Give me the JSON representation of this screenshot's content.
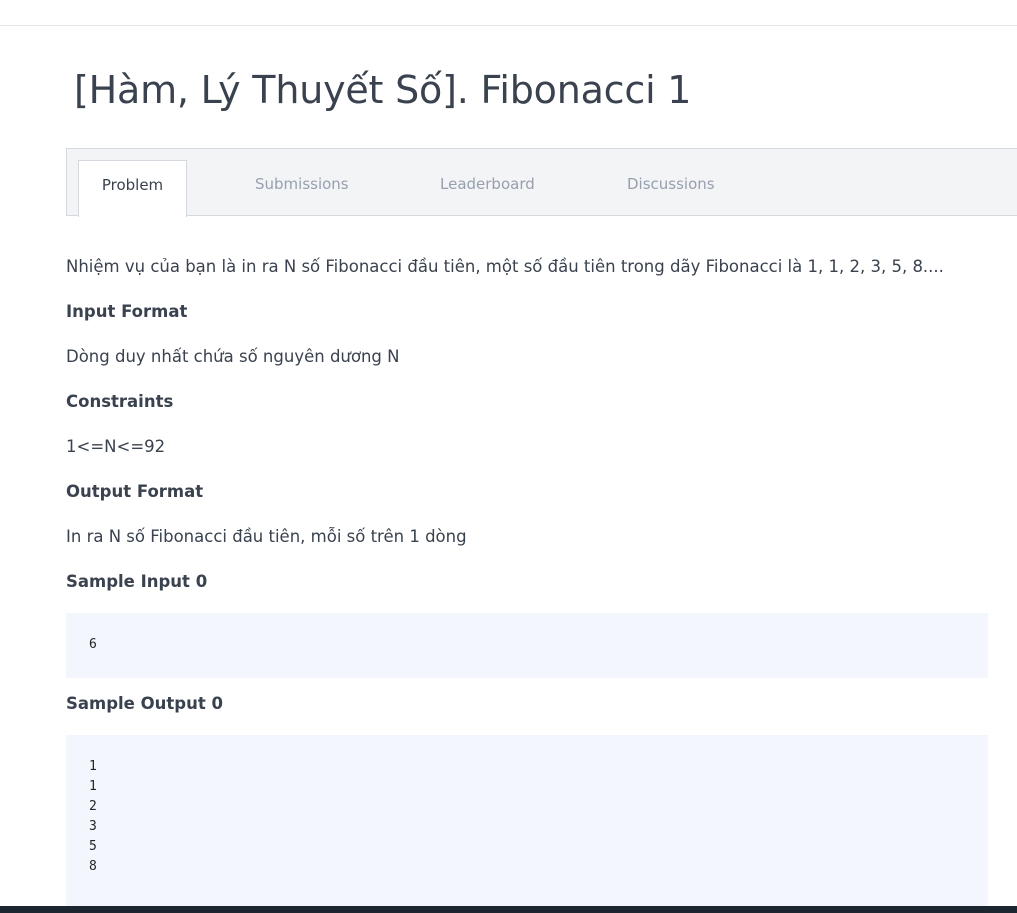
{
  "page": {
    "title": "[Hàm, Lý Thuyết Số]. Fibonacci 1"
  },
  "tabs": [
    {
      "label": "Problem",
      "active": true
    },
    {
      "label": "Submissions",
      "active": false
    },
    {
      "label": "Leaderboard",
      "active": false
    },
    {
      "label": "Discussions",
      "active": false
    }
  ],
  "problem": {
    "statement": "Nhiệm vụ của bạn là in ra N số Fibonacci đầu tiên, một số đầu tiên trong dãy Fibonacci là 1, 1, 2, 3, 5, 8....",
    "input_format_heading": "Input Format",
    "input_format": "Dòng duy nhất chứa số nguyên dương N",
    "constraints_heading": "Constraints",
    "constraints": "1<=N<=92",
    "output_format_heading": "Output Format",
    "output_format": "In ra N số Fibonacci đầu tiên, mỗi số trên 1 dòng",
    "sample_input_heading": "Sample Input 0",
    "sample_input": "6",
    "sample_output_heading": "Sample Output 0",
    "sample_output": "1\n1\n2\n3\n5\n8"
  },
  "colors": {
    "text": "#39424e",
    "muted_tab": "#979faf",
    "code_bg": "#f3f7fd",
    "footer_bar": "#1b2631"
  }
}
